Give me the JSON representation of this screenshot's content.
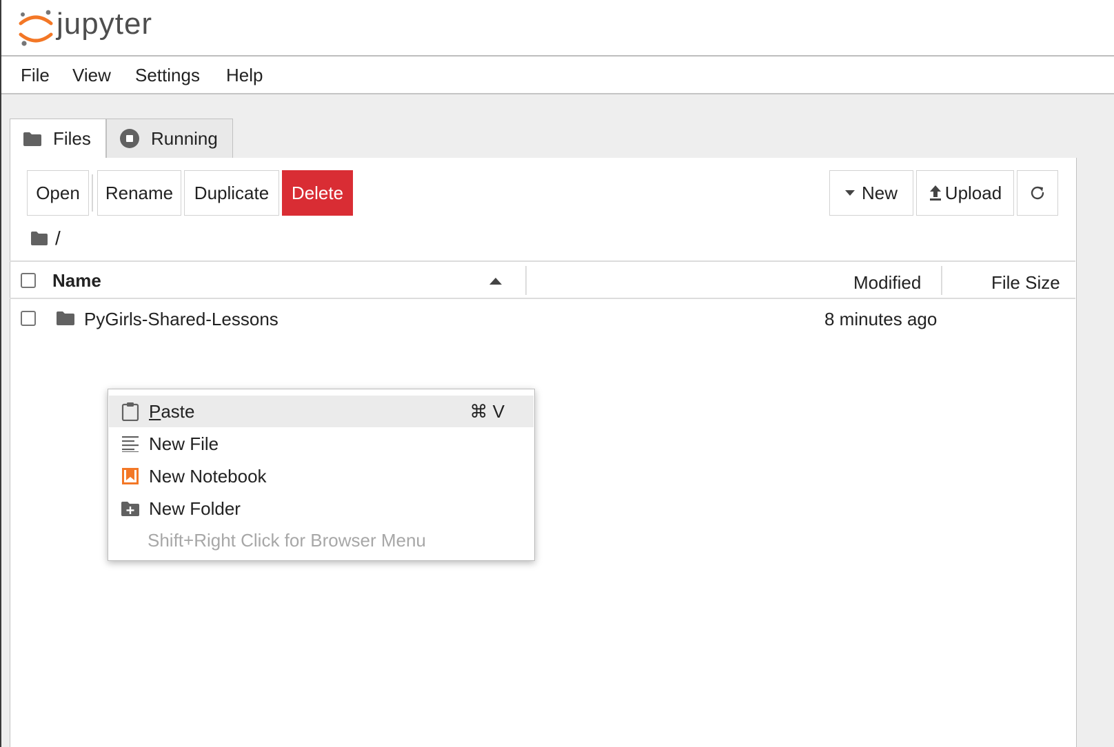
{
  "app": {
    "logo_text": "jupyter"
  },
  "menubar": {
    "items": [
      "File",
      "View",
      "Settings",
      "Help"
    ]
  },
  "tabs": [
    {
      "label": "Files",
      "icon": "folder-icon",
      "active": true
    },
    {
      "label": "Running",
      "icon": "stop-circle-icon",
      "active": false
    }
  ],
  "toolbar": {
    "open": "Open",
    "rename": "Rename",
    "duplicate": "Duplicate",
    "delete": "Delete",
    "new": "New",
    "upload": "Upload",
    "refresh_icon": "refresh-icon"
  },
  "breadcrumb": {
    "path": "/"
  },
  "table": {
    "columns": {
      "name": "Name",
      "modified": "Modified",
      "size": "File Size"
    },
    "sort": {
      "column": "Name",
      "direction": "ascending"
    },
    "rows": [
      {
        "type": "folder",
        "name": "PyGirls-Shared-Lessons",
        "modified": "8 minutes ago",
        "size": ""
      }
    ]
  },
  "context_menu": {
    "items": [
      {
        "label_mnemonic": "P",
        "label_rest": "aste",
        "shortcut": "⌘ V",
        "icon": "paste-icon"
      },
      {
        "label": "New File",
        "icon": "text-file-icon"
      },
      {
        "label": "New Notebook",
        "icon": "notebook-icon"
      },
      {
        "label": "New Folder",
        "icon": "new-folder-icon"
      }
    ],
    "hint": "Shift+Right Click for Browser Menu"
  },
  "colors": {
    "accent_orange": "#f37726",
    "delete_red": "#d92d34",
    "icon_gray": "#616161"
  }
}
